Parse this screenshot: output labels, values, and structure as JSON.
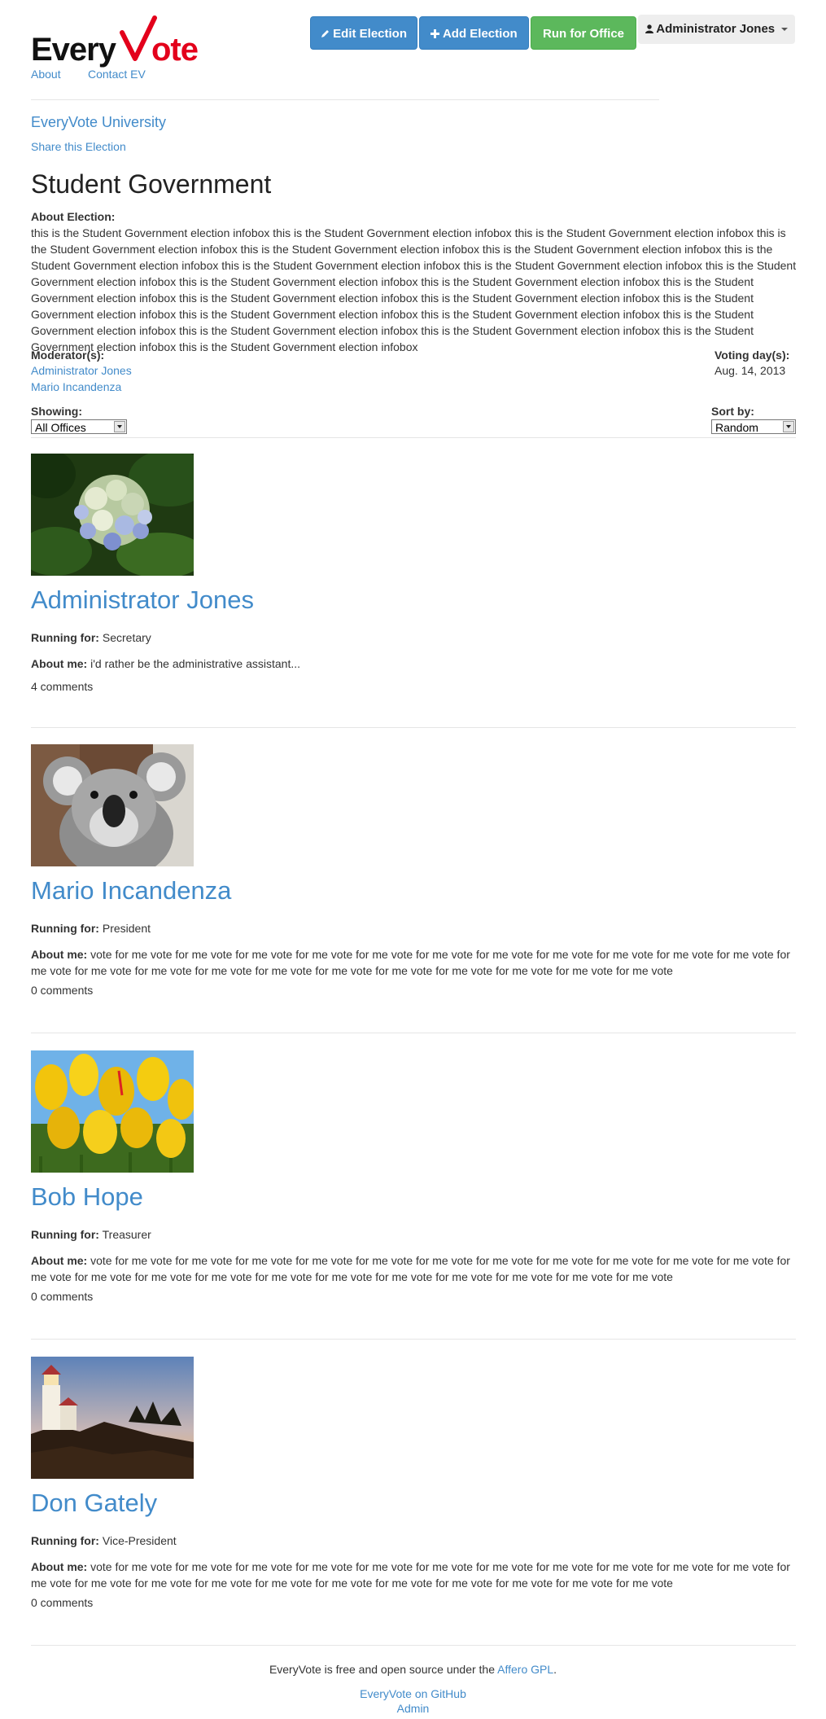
{
  "brand": {
    "logo_text_1": "Every",
    "logo_text_2": "Vote",
    "logo_accent": "#e3001b"
  },
  "nav": {
    "about": "About",
    "contact": "Contact EV"
  },
  "toolbar": {
    "edit_label": "Edit Election",
    "add_label": "Add Election",
    "run_label": "Run for Office",
    "user_label": "Administrator Jones"
  },
  "election": {
    "org": "EveryVote University",
    "share": "Share this Election",
    "title": "Student Government",
    "about_label": "About Election:",
    "about_text": "this is the Student Government election infobox this is the Student Government election infobox this is the Student Government election infobox this is the Student Government election infobox this is the Student Government election infobox this is the Student Government election infobox this is the Student Government election infobox this is the Student Government election infobox this is the Student Government election infobox this is the Student Government election infobox this is the Student Government election infobox this is the Student Government election infobox this is the Student Government election infobox this is the Student Government election infobox this is the Student Government election infobox this is the Student Government election infobox this is the Student Government election infobox this is the Student Government election infobox this is the Student Government election infobox this is the Student Government election infobox this is the Student Government election infobox this is the Student Government election infobox this is the Student Government election infobox",
    "moderators_label": "Moderator(s):",
    "moderators": [
      "Administrator Jones",
      "Mario Incandenza"
    ],
    "voting_label": "Voting day(s):",
    "voting_value": "Aug. 14, 2013",
    "showing_label": "Showing:",
    "showing_value": "All Offices",
    "sort_label": "Sort by:",
    "sort_value": "Random"
  },
  "labels": {
    "running_for": "Running for:",
    "about_me": "About me:"
  },
  "candidates": [
    {
      "name": "Administrator Jones",
      "office": "Secretary",
      "about": "i'd rather be the administrative assistant...",
      "comments": "4 comments",
      "photo": "hydrangea-photo"
    },
    {
      "name": "Mario Incandenza",
      "office": "President",
      "about": "vote for me vote for me vote for me vote for me vote for me vote for me vote for me vote for me vote for me vote for me vote for me vote for me vote for me vote for me vote for me vote for me vote for me vote for me vote for me vote for me vote for me vote for me vote",
      "comments": "0 comments",
      "photo": "koala-photo"
    },
    {
      "name": "Bob Hope",
      "office": "Treasurer",
      "about": "vote for me vote for me vote for me vote for me vote for me vote for me vote for me vote for me vote for me vote for me vote for me vote for me vote for me vote for me vote for me vote for me vote for me vote for me vote for me vote for me vote for me vote for me vote",
      "comments": "0 comments",
      "photo": "tulips-photo"
    },
    {
      "name": "Don Gately",
      "office": "Vice-President",
      "about": "vote for me vote for me vote for me vote for me vote for me vote for me vote for me vote for me vote for me vote for me vote for me vote for me vote for me vote for me vote for me vote for me vote for me vote for me vote for me vote for me vote for me vote for me vote",
      "comments": "0 comments",
      "photo": "lighthouse-photo"
    }
  ],
  "footer": {
    "text_prefix": "EveryVote is free and open source under the",
    "license_link": "Affero GPL",
    "github": "EveryVote on GitHub",
    "admin": "Admin"
  }
}
